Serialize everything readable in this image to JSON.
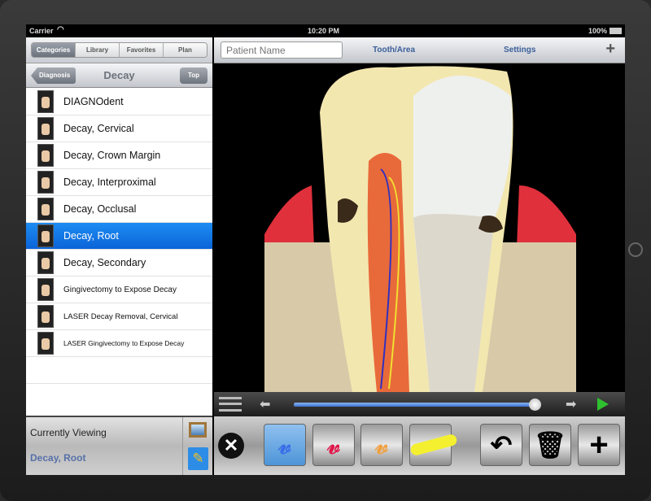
{
  "status": {
    "carrier": "Carrier",
    "time": "10:20 PM",
    "battery": "100%"
  },
  "tabs": [
    {
      "label": "Categories",
      "active": true
    },
    {
      "label": "Library"
    },
    {
      "label": "Favorites"
    },
    {
      "label": "Plan"
    }
  ],
  "nav": {
    "back": "Diagnosis",
    "title": "Decay",
    "top": "Top"
  },
  "list": [
    {
      "label": "DIAGNOdent"
    },
    {
      "label": "Decay, Cervical"
    },
    {
      "label": "Decay, Crown Margin"
    },
    {
      "label": "Decay, Interproximal"
    },
    {
      "label": "Decay, Occlusal"
    },
    {
      "label": "Decay, Root",
      "selected": true
    },
    {
      "label": "Decay, Secondary"
    },
    {
      "label": "Gingivectomy to Expose Decay"
    },
    {
      "label": "LASER Decay Removal, Cervical"
    },
    {
      "label": "LASER Gingivectomy to Expose Decay"
    }
  ],
  "viewing": {
    "label": "Currently Viewing",
    "value": "Decay, Root"
  },
  "toolbar": {
    "patient_placeholder": "Patient Name",
    "tooth_area": "Tooth/Area",
    "settings": "Settings",
    "add": "+"
  },
  "playback": {
    "progress_percent": 99
  },
  "draw_colors": {
    "blue": "#3a6ee8",
    "red": "#e0174a",
    "orange": "#f0a040",
    "highlight": "#f4f030"
  }
}
